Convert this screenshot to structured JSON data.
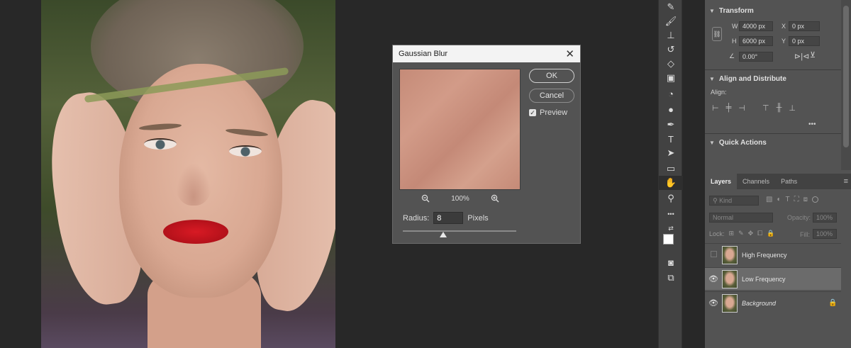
{
  "dialog": {
    "title": "Gaussian Blur",
    "close_glyph": "✕",
    "ok_label": "OK",
    "cancel_label": "Cancel",
    "preview_label": "Preview",
    "preview_checked": true,
    "zoom_value": "100%",
    "radius_label": "Radius:",
    "radius_value": "8",
    "radius_unit": "Pixels"
  },
  "toolbar": {
    "icons": [
      "brush-icon",
      "stamp-icon",
      "history-brush-icon",
      "eraser-icon",
      "gradient-icon",
      "blur-icon",
      "dodge-icon",
      "pen-icon",
      "type-icon",
      "path-select-icon",
      "rectangle-icon",
      "hand-icon",
      "zoom-icon",
      "more-icon"
    ],
    "type_glyph": "T",
    "more_glyph": "•••",
    "active_tool": "hand-icon"
  },
  "properties": {
    "transform": {
      "title": "Transform",
      "w_label": "W",
      "w_value": "4000 px",
      "h_label": "H",
      "h_value": "6000 px",
      "x_label": "X",
      "x_value": "0 px",
      "y_label": "Y",
      "y_value": "0 px",
      "angle_value": "0.00°"
    },
    "align": {
      "title": "Align and Distribute",
      "align_label": "Align:",
      "more_glyph": "•••"
    },
    "quick_actions": {
      "title": "Quick Actions"
    }
  },
  "layers_panel": {
    "tabs": [
      "Layers",
      "Channels",
      "Paths"
    ],
    "search_placeholder": "Kind",
    "blend_mode": "Normal",
    "opacity_label": "Opacity:",
    "opacity_value": "100%",
    "lock_label": "Lock:",
    "fill_label": "Fill:",
    "fill_value": "100%",
    "layers": [
      {
        "name": "High Frequency",
        "visible": false,
        "selected": false,
        "locked": false
      },
      {
        "name": "Low Frequency",
        "visible": true,
        "selected": true,
        "locked": false
      },
      {
        "name": "Background",
        "visible": true,
        "selected": false,
        "locked": true
      }
    ]
  }
}
